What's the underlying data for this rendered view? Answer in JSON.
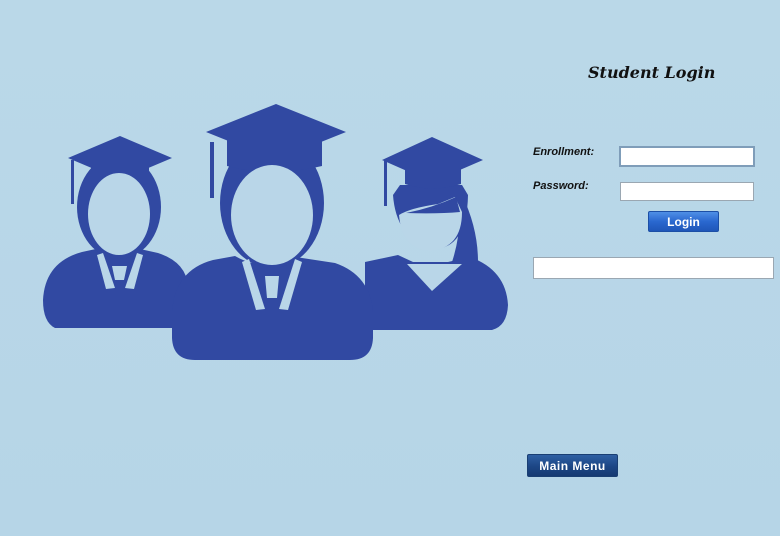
{
  "header": {
    "title": "Student Login"
  },
  "form": {
    "enrollment_label": "Enrollment:",
    "enrollment_value": "",
    "password_label": "Password:",
    "password_value": "",
    "login_label": "Login",
    "result_value": ""
  },
  "footer": {
    "main_menu_label": "Main Menu"
  },
  "illustration": {
    "icon": "graduates-group-icon",
    "color": "#3149a2"
  },
  "colors": {
    "background": "#b8d7e8",
    "login_button": "#2a68cf",
    "main_menu_button": "#1c4685"
  }
}
